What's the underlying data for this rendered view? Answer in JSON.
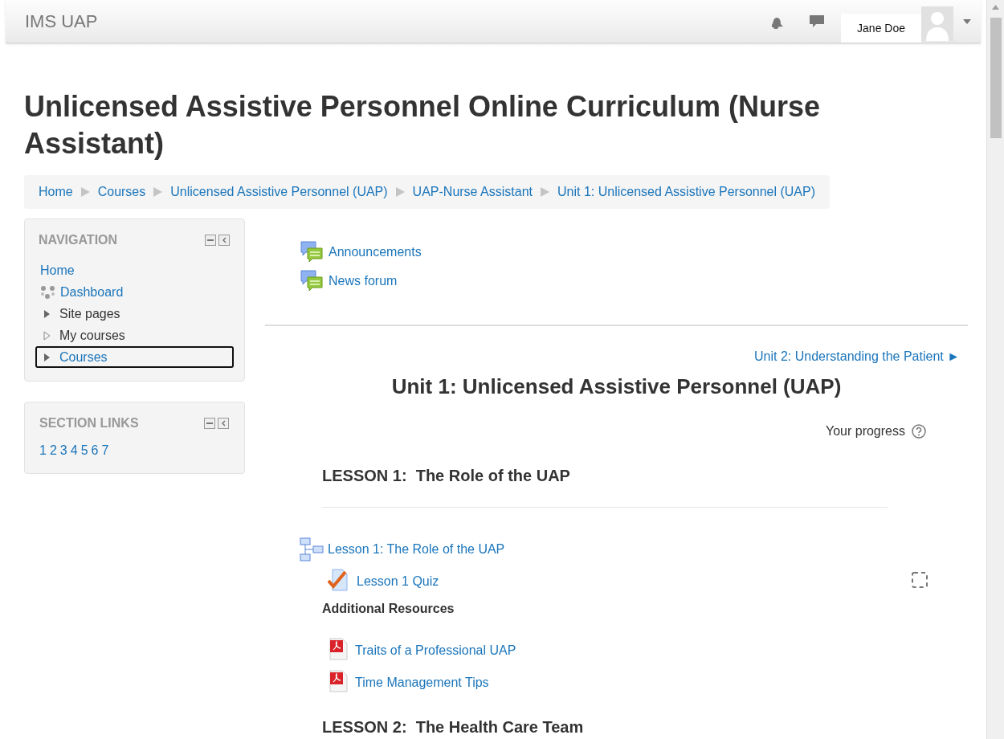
{
  "navbar": {
    "brand": "IMS UAP",
    "user_name": "Jane Doe"
  },
  "page_title": "Unlicensed Assistive Personnel Online Curriculum (Nurse Assistant)",
  "breadcrumbs": [
    "Home",
    "Courses",
    "Unlicensed Assistive Personnel (UAP)",
    "UAP-Nurse Assistant",
    "Unit 1: Unlicensed Assistive Personnel (UAP)"
  ],
  "navigation_block": {
    "title": "NAVIGATION",
    "items": [
      {
        "label": "Home",
        "kind": "link",
        "linked": true,
        "selected": false
      },
      {
        "label": "Dashboard",
        "kind": "dashboard",
        "linked": true,
        "selected": false
      },
      {
        "label": "Site pages",
        "kind": "branch",
        "has_children": true,
        "linked": false,
        "selected": false
      },
      {
        "label": "My courses",
        "kind": "branch",
        "has_children": false,
        "linked": false,
        "selected": false
      },
      {
        "label": "Courses",
        "kind": "branch",
        "has_children": true,
        "linked": true,
        "selected": true
      }
    ]
  },
  "section_links_block": {
    "title": "SECTION LINKS",
    "links": [
      "1",
      "2",
      "3",
      "4",
      "5",
      "6",
      "7"
    ]
  },
  "forums": [
    "Announcements",
    "News forum"
  ],
  "next_section": "Unit 2: Understanding the Patient ►",
  "section_title": "Unit 1: Unlicensed Assistive Personnel (UAP)",
  "progress_label": "Your progress",
  "lessons": [
    {
      "heading": "LESSON 1:  The Role of the UAP",
      "items": [
        {
          "kind": "lesson",
          "label": "Lesson 1: The Role of the UAP"
        },
        {
          "kind": "quiz",
          "label": "Lesson 1 Quiz",
          "completion": true
        },
        {
          "kind": "label",
          "label": "Additional Resources"
        },
        {
          "kind": "pdf",
          "label": "Traits of a Professional UAP"
        },
        {
          "kind": "pdf",
          "label": "Time Management Tips"
        }
      ]
    },
    {
      "heading": "LESSON 2:  The Health Care Team"
    }
  ]
}
